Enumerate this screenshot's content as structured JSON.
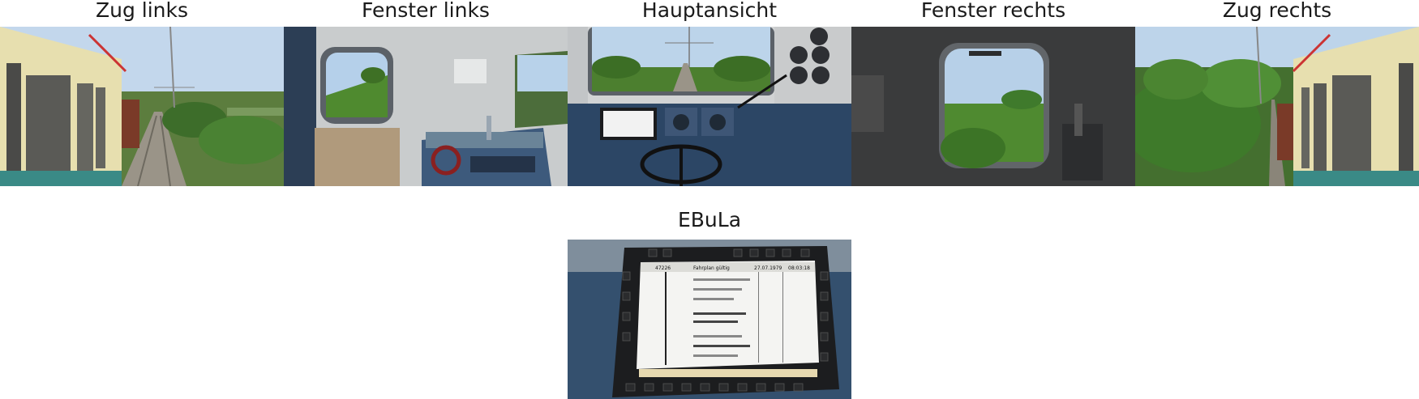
{
  "views": [
    {
      "label": "Zug links"
    },
    {
      "label": "Fenster links"
    },
    {
      "label": "Hauptansicht"
    },
    {
      "label": "Fenster rechts"
    },
    {
      "label": "Zug rechts"
    }
  ],
  "ebula": {
    "label": "EBuLa",
    "screen": {
      "train_no": "47226",
      "mode": "Fahrplan gültig",
      "date": "27.07.1979",
      "time": "08:03:18"
    }
  },
  "colors": {
    "sky": "#b9d2ea",
    "foliage": "#3f7a2c",
    "cab_blue": "#2e4a6b",
    "cab_grey": "#c9cccd",
    "loco_cream": "#e8dfae"
  }
}
